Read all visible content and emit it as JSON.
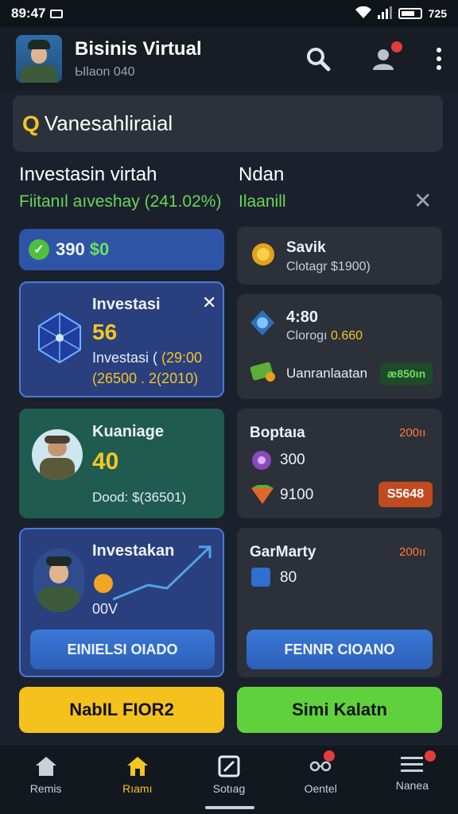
{
  "status": {
    "time": "89:47",
    "right_text": "725"
  },
  "app": {
    "title": "Bisinis Virtual",
    "subtitle": "Ыlaon 040"
  },
  "search": {
    "text": "Vanesahliraial"
  },
  "left_section": {
    "title": "Investasin virtah",
    "subtitle": "Fiitanıl aıveshay (241.02%)"
  },
  "right_section": {
    "title": "Ndan",
    "subtitle": "Ilaanill"
  },
  "balance": {
    "value": "390",
    "highlight": "$0"
  },
  "invest_card": {
    "title": "Investasi",
    "value": "56",
    "line1": "Investasi ( ",
    "line1_highlight": "(29:00",
    "line2": "(26500 . 2(2010)"
  },
  "knowledge_card": {
    "title": "Kuaniage",
    "value": "40",
    "footer": "Dood: $(36501)"
  },
  "officer_card": {
    "title": "Investakan",
    "value": "00V",
    "button": "EINIELSI OIADO"
  },
  "savik_card": {
    "title": "Savik",
    "sub": "Clotagr $1900)"
  },
  "clock_card": {
    "title": "4:80",
    "sub": "Clorogı",
    "sub_highlight": "0.660",
    "row_label": "Uanranlaatan",
    "row_badge": "æ850ın"
  },
  "boptana_card": {
    "title": "Boptaıa",
    "tag": "200ıı",
    "row1": "300",
    "row2": "9100",
    "badge": "S5648"
  },
  "gamarty_card": {
    "title": "GarMarty",
    "tag": "200ıı",
    "row1": "80",
    "button": "FENNR CIOANO"
  },
  "buttons": {
    "yellow": "NabIL FIOR2",
    "green": "Simi Kalatn"
  },
  "nav": [
    {
      "label": "Remis"
    },
    {
      "label": "Rıamı"
    },
    {
      "label": "Sotıag"
    },
    {
      "label": "Oentel"
    },
    {
      "label": "Nanea"
    }
  ],
  "colors": {
    "accent": "#f3c623",
    "green": "#5fd13c",
    "blue": "#3b78d6",
    "orange": "#ff7a3a"
  }
}
